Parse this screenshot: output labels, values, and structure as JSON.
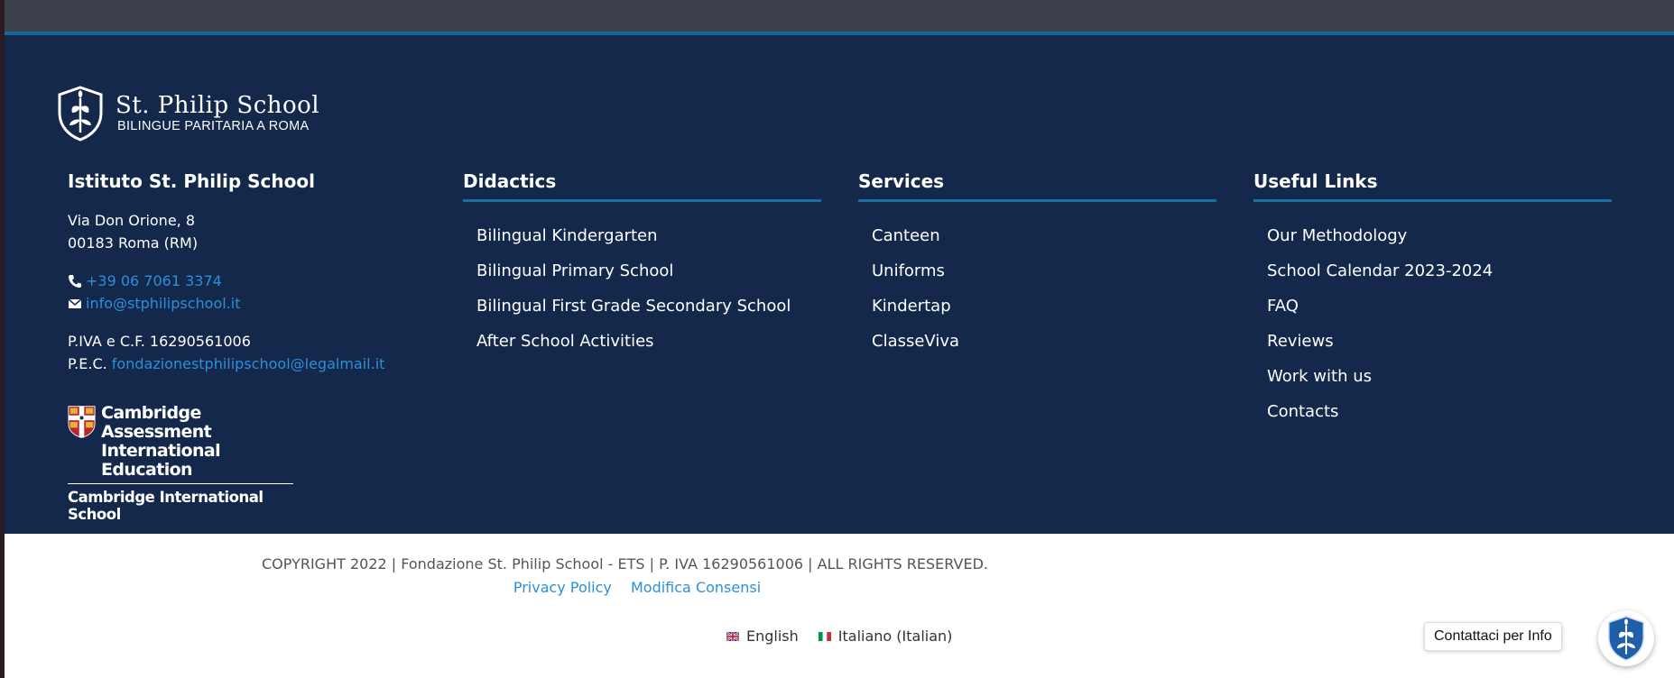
{
  "logo": {
    "title": "St. Philip School",
    "subtitle": "BILINGUE PARITARIA A ROMA"
  },
  "info": {
    "heading": "Istituto St. Philip School",
    "address_line1": "Via Don Orione, 8",
    "address_line2": "00183 Roma (RM)",
    "phone": "+39 06 7061 3374",
    "email": "info@stphilipschool.it",
    "vat": "P.IVA e C.F. 16290561006",
    "pec_label": "P.E.C.",
    "pec_email": "fondazionestphilipschool@legalmail.it"
  },
  "cambridge": {
    "line1": "Cambridge Assessment",
    "line2": "International Education",
    "school": "Cambridge International School"
  },
  "didactics": {
    "heading": "Didactics",
    "items": [
      "Bilingual Kindergarten",
      "Bilingual Primary School",
      "Bilingual First Grade Secondary School",
      "After School Activities"
    ]
  },
  "services": {
    "heading": "Services",
    "items": [
      "Canteen",
      "Uniforms",
      "Kindertap",
      "ClasseViva"
    ]
  },
  "useful_links": {
    "heading": "Useful Links",
    "items": [
      "Our Methodology",
      "School Calendar 2023-2024",
      "FAQ",
      "Reviews",
      "Work with us",
      "Contacts"
    ]
  },
  "bottom": {
    "copyright": "COPYRIGHT 2022 | Fondazione St. Philip School - ETS | P. IVA 16290561006 | ALL RIGHTS RESERVED.",
    "privacy": "Privacy Policy",
    "consent": "Modifica Consensi",
    "lang_en": "English",
    "lang_it": "Italiano (Italian)"
  },
  "chat": {
    "label": "Contattaci per Info"
  },
  "colors": {
    "footer_bg": "#13284a",
    "accent": "#1b6ea1",
    "link": "#2d8fd8"
  }
}
